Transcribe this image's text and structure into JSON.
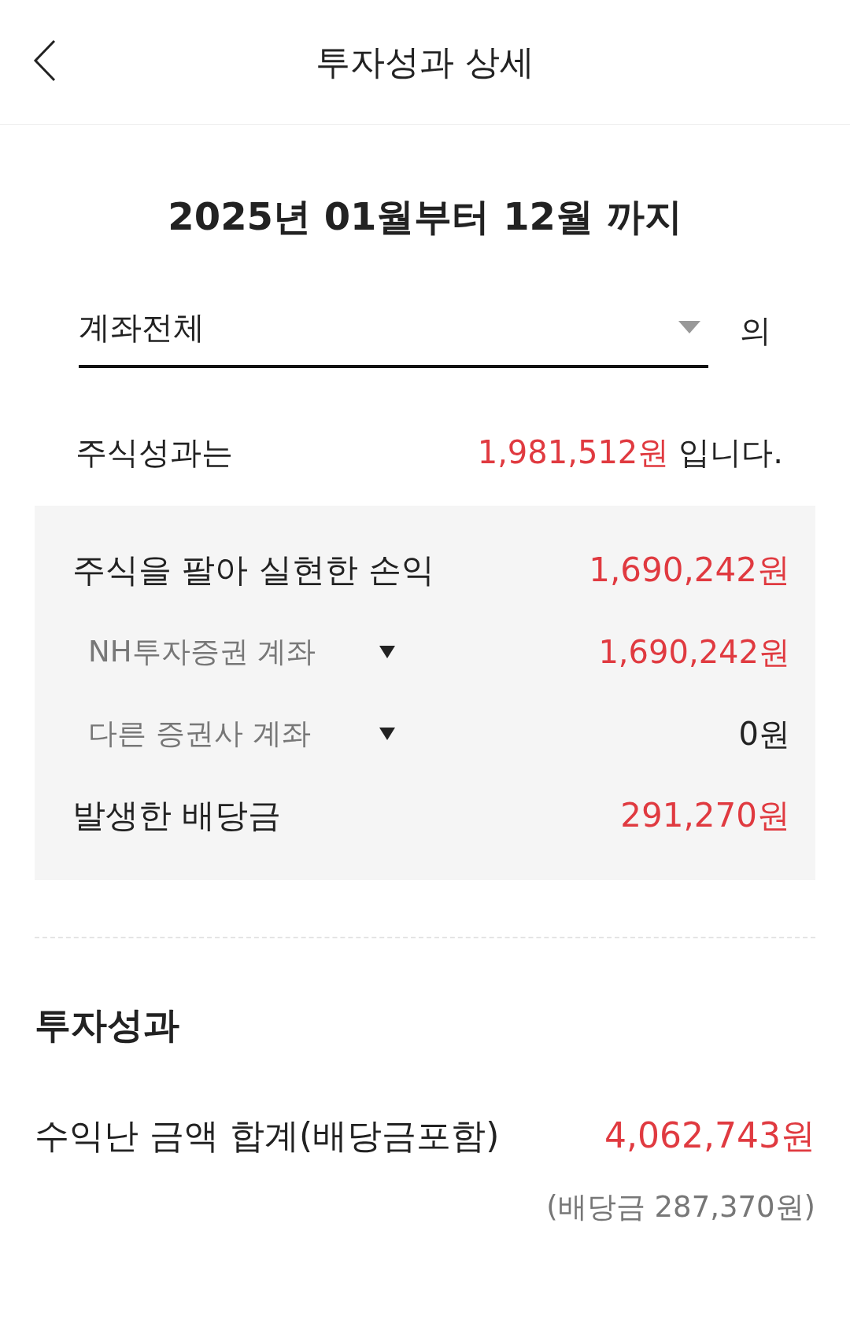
{
  "header": {
    "title": "투자성과 상세"
  },
  "period": "2025년 01월부터 12월 까지",
  "account_select": {
    "value": "계좌전체",
    "suffix": "의"
  },
  "summary": {
    "label": "주식성과는",
    "amount": "1,981,512원",
    "suffix": "입니다."
  },
  "breakdown": [
    {
      "kind": "main",
      "label": "주식을 팔아 실현한 손익",
      "amount": "1,690,242원",
      "positive": true
    },
    {
      "kind": "sub",
      "label": "NH투자증권 계좌",
      "amount": "1,690,242원",
      "positive": true
    },
    {
      "kind": "sub",
      "label": "다른 증권사 계좌",
      "amount": "0원",
      "positive": false
    },
    {
      "kind": "main",
      "label": "발생한 배당금",
      "amount": "291,270원",
      "positive": true
    }
  ],
  "performance": {
    "title": "투자성과",
    "rows": [
      {
        "label": "수익난 금액 합계(배당금포함)",
        "amount": "4,062,743원",
        "note": "(배당금 287,370원)"
      }
    ]
  }
}
